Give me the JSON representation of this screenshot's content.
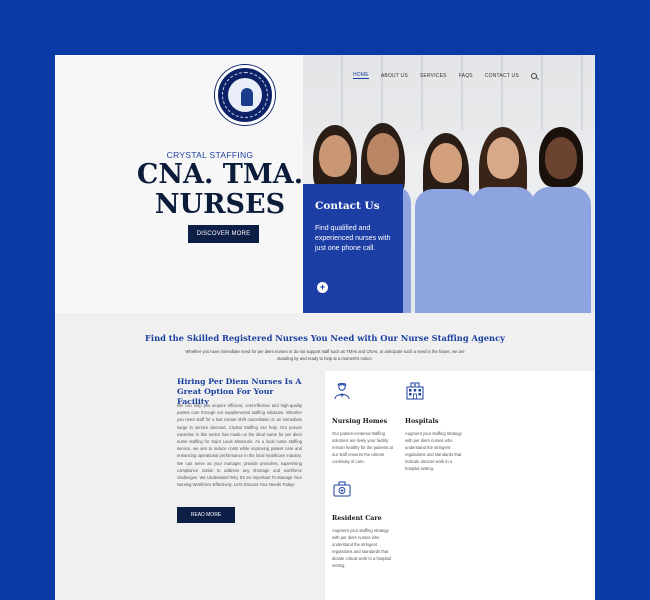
{
  "header": {
    "brand_sub": "CRYSTAL STAFFING",
    "title_line1": "CNA. TMA.",
    "title_line2": "NURSES",
    "discover_label": "DISCOVER MORE"
  },
  "nav": {
    "items": [
      "HOME",
      "ABOUT US",
      "SERVICES",
      "FAQS",
      "CONTACT US"
    ],
    "active": "HOME"
  },
  "contact": {
    "title": "Contact Us",
    "text": "Find qualified and experienced nurses with just one phone call.",
    "button": "+"
  },
  "section": {
    "heading": "Find the Skilled Registered Nurses You Need with Our Nurse Staffing Agency",
    "intro": "Whether you have immediate need for per diem nurses or do not support staff such as TMAs and CNAs, or anticipate such a need in the future, we are standing by and ready to help at a moment's notice."
  },
  "hiring": {
    "title": "Hiring Per Diem Nurses Is A Great Option For Your Facility",
    "body": "We can help you acquire efficient, cost-effective and high-quality patient care through our supplemental staffing solutions. Whether you need staff for a last minute shift cancellation or an immediate surge in service demand, Crystal Staffing can help. Our proven expertise in this sector has made us the ideal name for per diem nurse staffing for Saint Louis Missouris. As a local nurse staffing service, we aim to reduce costs while improving patient care and enhancing operational performance in the local healthcare industry. We can serve as your manager, provide providers, supervising compliance nation to address any shortage and workforce challenges. We Understand Why It's So Important To Manage Your Nursing Workforce Effectively. Let's Discuss Your Needs Today!",
    "read_more": "READ MORE"
  },
  "services": [
    {
      "title": "Nursing Homes",
      "text": "Our patient-centered staffing solutions are lively your facility remain healthy for the patients at our staff ensures the utmost continuity of care."
    },
    {
      "title": "Hospitals",
      "text": "Augment your staffing strategy with per diem nurses who understand the stringent regulations and standards that indicate doctors work in a hospital setting."
    },
    {
      "title": "Resident Care",
      "text": "Augment your staffing strategy with per diem nurses who understand the stringent regulations and standards that dictate critical work in a hospital setting."
    }
  ],
  "colors": {
    "background": "#0a3aa6",
    "accent": "#1a3f9f",
    "navy": "#0d1f47",
    "card": "#1d3ea5"
  }
}
